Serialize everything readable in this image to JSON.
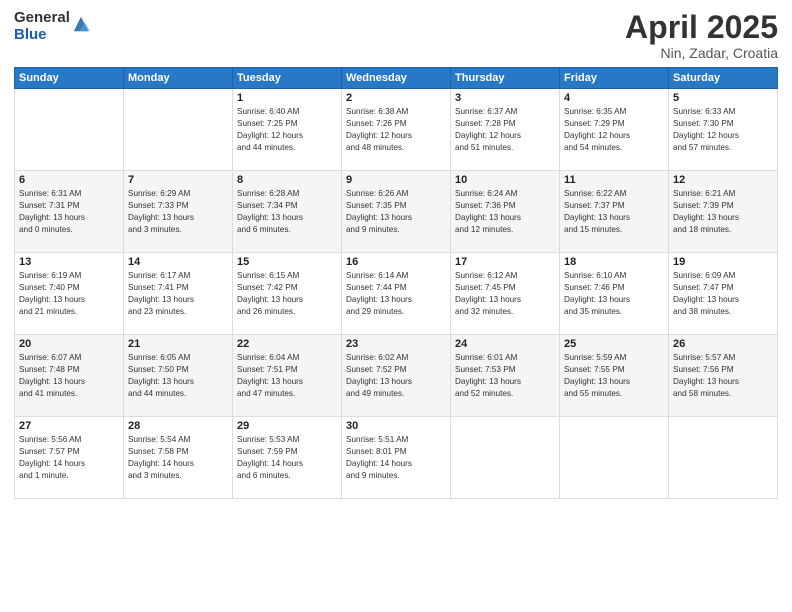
{
  "logo": {
    "general": "General",
    "blue": "Blue"
  },
  "title": {
    "month": "April 2025",
    "location": "Nin, Zadar, Croatia"
  },
  "headers": [
    "Sunday",
    "Monday",
    "Tuesday",
    "Wednesday",
    "Thursday",
    "Friday",
    "Saturday"
  ],
  "weeks": [
    [
      {
        "day": "",
        "info": ""
      },
      {
        "day": "",
        "info": ""
      },
      {
        "day": "1",
        "info": "Sunrise: 6:40 AM\nSunset: 7:25 PM\nDaylight: 12 hours\nand 44 minutes."
      },
      {
        "day": "2",
        "info": "Sunrise: 6:38 AM\nSunset: 7:26 PM\nDaylight: 12 hours\nand 48 minutes."
      },
      {
        "day": "3",
        "info": "Sunrise: 6:37 AM\nSunset: 7:28 PM\nDaylight: 12 hours\nand 51 minutes."
      },
      {
        "day": "4",
        "info": "Sunrise: 6:35 AM\nSunset: 7:29 PM\nDaylight: 12 hours\nand 54 minutes."
      },
      {
        "day": "5",
        "info": "Sunrise: 6:33 AM\nSunset: 7:30 PM\nDaylight: 12 hours\nand 57 minutes."
      }
    ],
    [
      {
        "day": "6",
        "info": "Sunrise: 6:31 AM\nSunset: 7:31 PM\nDaylight: 13 hours\nand 0 minutes."
      },
      {
        "day": "7",
        "info": "Sunrise: 6:29 AM\nSunset: 7:33 PM\nDaylight: 13 hours\nand 3 minutes."
      },
      {
        "day": "8",
        "info": "Sunrise: 6:28 AM\nSunset: 7:34 PM\nDaylight: 13 hours\nand 6 minutes."
      },
      {
        "day": "9",
        "info": "Sunrise: 6:26 AM\nSunset: 7:35 PM\nDaylight: 13 hours\nand 9 minutes."
      },
      {
        "day": "10",
        "info": "Sunrise: 6:24 AM\nSunset: 7:36 PM\nDaylight: 13 hours\nand 12 minutes."
      },
      {
        "day": "11",
        "info": "Sunrise: 6:22 AM\nSunset: 7:37 PM\nDaylight: 13 hours\nand 15 minutes."
      },
      {
        "day": "12",
        "info": "Sunrise: 6:21 AM\nSunset: 7:39 PM\nDaylight: 13 hours\nand 18 minutes."
      }
    ],
    [
      {
        "day": "13",
        "info": "Sunrise: 6:19 AM\nSunset: 7:40 PM\nDaylight: 13 hours\nand 21 minutes."
      },
      {
        "day": "14",
        "info": "Sunrise: 6:17 AM\nSunset: 7:41 PM\nDaylight: 13 hours\nand 23 minutes."
      },
      {
        "day": "15",
        "info": "Sunrise: 6:15 AM\nSunset: 7:42 PM\nDaylight: 13 hours\nand 26 minutes."
      },
      {
        "day": "16",
        "info": "Sunrise: 6:14 AM\nSunset: 7:44 PM\nDaylight: 13 hours\nand 29 minutes."
      },
      {
        "day": "17",
        "info": "Sunrise: 6:12 AM\nSunset: 7:45 PM\nDaylight: 13 hours\nand 32 minutes."
      },
      {
        "day": "18",
        "info": "Sunrise: 6:10 AM\nSunset: 7:46 PM\nDaylight: 13 hours\nand 35 minutes."
      },
      {
        "day": "19",
        "info": "Sunrise: 6:09 AM\nSunset: 7:47 PM\nDaylight: 13 hours\nand 38 minutes."
      }
    ],
    [
      {
        "day": "20",
        "info": "Sunrise: 6:07 AM\nSunset: 7:48 PM\nDaylight: 13 hours\nand 41 minutes."
      },
      {
        "day": "21",
        "info": "Sunrise: 6:05 AM\nSunset: 7:50 PM\nDaylight: 13 hours\nand 44 minutes."
      },
      {
        "day": "22",
        "info": "Sunrise: 6:04 AM\nSunset: 7:51 PM\nDaylight: 13 hours\nand 47 minutes."
      },
      {
        "day": "23",
        "info": "Sunrise: 6:02 AM\nSunset: 7:52 PM\nDaylight: 13 hours\nand 49 minutes."
      },
      {
        "day": "24",
        "info": "Sunrise: 6:01 AM\nSunset: 7:53 PM\nDaylight: 13 hours\nand 52 minutes."
      },
      {
        "day": "25",
        "info": "Sunrise: 5:59 AM\nSunset: 7:55 PM\nDaylight: 13 hours\nand 55 minutes."
      },
      {
        "day": "26",
        "info": "Sunrise: 5:57 AM\nSunset: 7:56 PM\nDaylight: 13 hours\nand 58 minutes."
      }
    ],
    [
      {
        "day": "27",
        "info": "Sunrise: 5:56 AM\nSunset: 7:57 PM\nDaylight: 14 hours\nand 1 minute."
      },
      {
        "day": "28",
        "info": "Sunrise: 5:54 AM\nSunset: 7:58 PM\nDaylight: 14 hours\nand 3 minutes."
      },
      {
        "day": "29",
        "info": "Sunrise: 5:53 AM\nSunset: 7:59 PM\nDaylight: 14 hours\nand 6 minutes."
      },
      {
        "day": "30",
        "info": "Sunrise: 5:51 AM\nSunset: 8:01 PM\nDaylight: 14 hours\nand 9 minutes."
      },
      {
        "day": "",
        "info": ""
      },
      {
        "day": "",
        "info": ""
      },
      {
        "day": "",
        "info": ""
      }
    ]
  ]
}
